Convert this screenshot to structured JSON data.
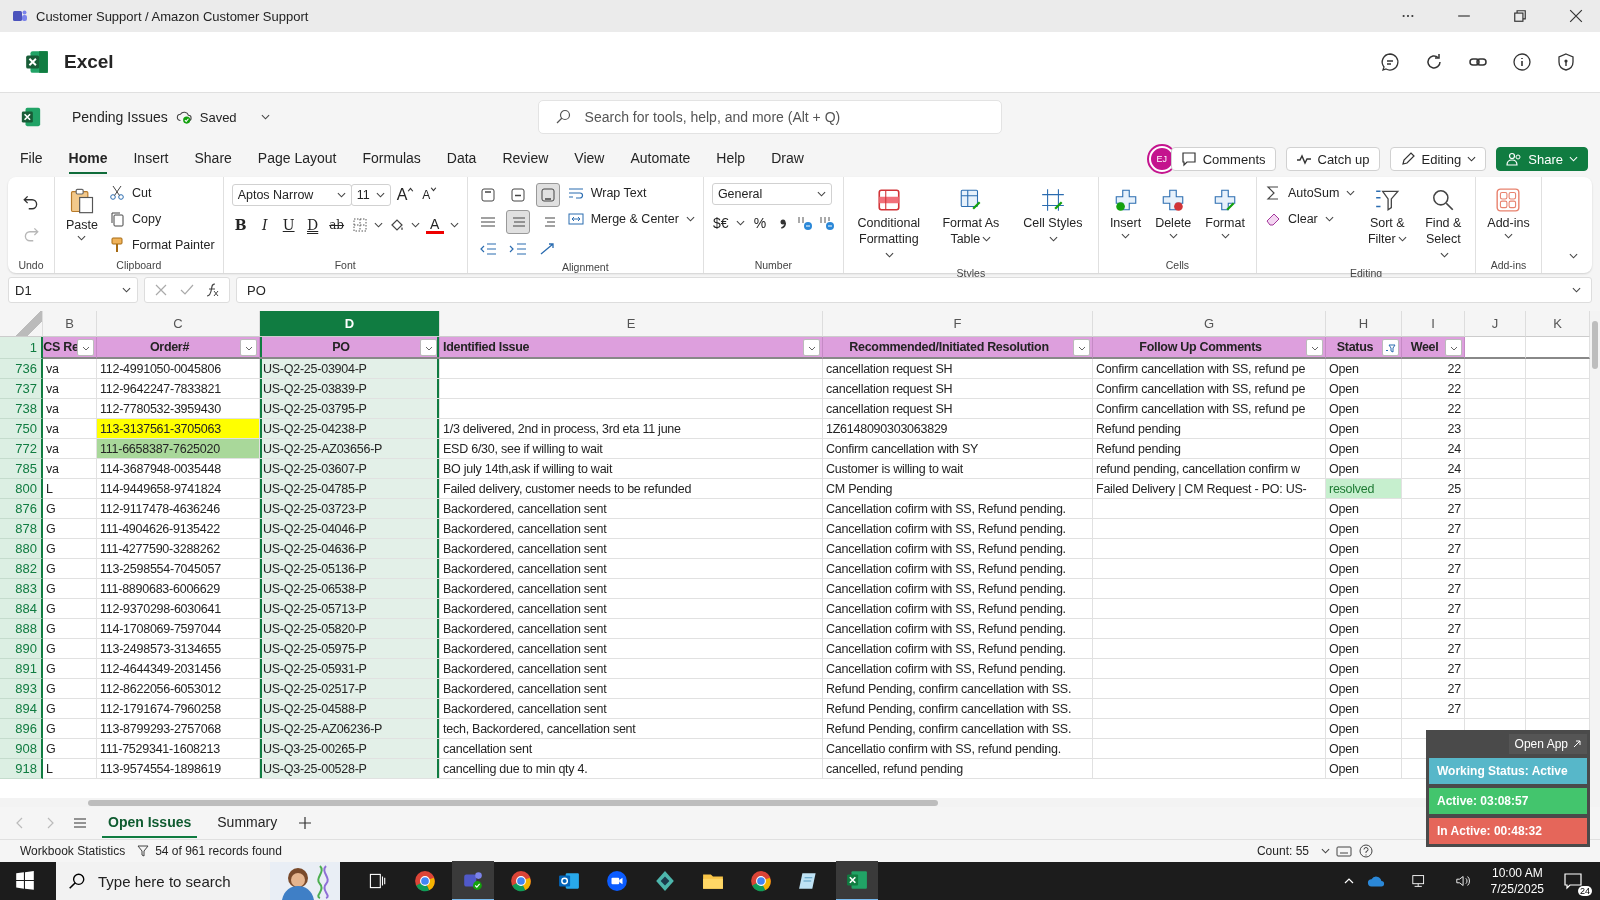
{
  "title_bar": {
    "title": "Customer Support / Amazon Customer Support"
  },
  "app_header": {
    "app_name": "Excel"
  },
  "document": {
    "name": "Pending Issues",
    "save_status": "Saved"
  },
  "search": {
    "placeholder": "Search for tools, help, and more (Alt + Q)"
  },
  "menu_tabs": [
    {
      "label": "File",
      "selected": false
    },
    {
      "label": "Home",
      "selected": true
    },
    {
      "label": "Insert",
      "selected": false
    },
    {
      "label": "Share",
      "selected": false
    },
    {
      "label": "Page Layout",
      "selected": false
    },
    {
      "label": "Formulas",
      "selected": false
    },
    {
      "label": "Data",
      "selected": false
    },
    {
      "label": "Review",
      "selected": false
    },
    {
      "label": "View",
      "selected": false
    },
    {
      "label": "Automate",
      "selected": false
    },
    {
      "label": "Help",
      "selected": false
    },
    {
      "label": "Draw",
      "selected": false
    }
  ],
  "collaboration": {
    "avatar": "EJ",
    "comments": "Comments",
    "catch_up": "Catch up",
    "mode": "Editing",
    "share": "Share"
  },
  "ribbon": {
    "undo": {
      "label": "Undo",
      "undo_disabled": false,
      "redo_disabled": true
    },
    "clipboard": {
      "label": "Clipboard",
      "paste": "Paste",
      "cut": "Cut",
      "copy": "Copy",
      "format_painter": "Format Painter"
    },
    "font": {
      "label": "Font",
      "family": "Aptos Narrow",
      "size": "11",
      "grow": "A",
      "shrink": "A",
      "format_buttons": [
        "B",
        "I",
        "U",
        "D",
        "ab"
      ],
      "font_color": "A"
    },
    "alignment": {
      "label": "Alignment",
      "vertical": [
        {
          "selected": false
        },
        {
          "selected": false
        },
        {
          "selected": true
        }
      ],
      "horizontal": [
        {
          "selected": false
        },
        {
          "selected": true
        },
        {
          "selected": false
        }
      ],
      "wrap": "Wrap Text",
      "merge": "Merge & Center"
    },
    "number": {
      "label": "Number",
      "format": "General",
      "currency": "$€",
      "percent": "%"
    },
    "styles": {
      "label": "Styles",
      "buttons": [
        "Conditional Formatting",
        "Format As Table",
        "Cell Styles"
      ]
    },
    "cells": {
      "label": "Cells",
      "buttons": [
        "Insert",
        "Delete",
        "Format"
      ]
    },
    "editing": {
      "label": "Editing",
      "autosum": "AutoSum",
      "clear": "Clear",
      "sort": "Sort & Filter",
      "find": "Find & Select"
    },
    "addins": {
      "label": "Add-ins",
      "button": "Add-ins"
    }
  },
  "formula_bar": {
    "name_box": "D1",
    "formula": "PO"
  },
  "sheet": {
    "header_row": "1",
    "columns": [
      {
        "letter": "B",
        "header": "CS Re",
        "selected": false,
        "filtered": false
      },
      {
        "letter": "C",
        "header": "Order#",
        "selected": false,
        "filtered": false
      },
      {
        "letter": "D",
        "header": "PO",
        "selected": true,
        "filtered": false
      },
      {
        "letter": "E",
        "header": "Identified Issue",
        "selected": false,
        "filtered": false
      },
      {
        "letter": "F",
        "header": "Recommended/Initiated Resolution",
        "selected": false,
        "filtered": false
      },
      {
        "letter": "G",
        "header": "Follow Up Comments",
        "selected": false,
        "filtered": false
      },
      {
        "letter": "H",
        "header": "Status",
        "selected": false,
        "filtered": true
      },
      {
        "letter": "I",
        "header": "Weel",
        "selected": false,
        "filtered": false
      },
      {
        "letter": "J",
        "selected": false
      },
      {
        "letter": "K",
        "selected": false
      }
    ],
    "rows": [
      {
        "number": "736",
        "rep": "va",
        "order": "112-4991050-0045806",
        "po": "US-Q2-25-03904-P",
        "resolution": "cancellation request SH",
        "follow_up": "Confirm cancellation with SS, refund pe",
        "status": "Open",
        "week": "22"
      },
      {
        "number": "737",
        "rep": "va",
        "order": "112-9642247-7833821",
        "po": "US-Q2-25-03839-P",
        "resolution": "cancellation request SH",
        "follow_up": "Confirm cancellation with SS, refund pe",
        "status": "Open",
        "week": "22"
      },
      {
        "number": "738",
        "rep": "va",
        "order": "112-7780532-3959430",
        "po": "US-Q2-25-03795-P",
        "resolution": "cancellation request SH",
        "follow_up": "Confirm cancellation with SS, refund pe",
        "status": "Open",
        "week": "22"
      },
      {
        "number": "750",
        "rep": "va",
        "order": {
          "text": "113-3137561-3705063",
          "color": "#ffff00"
        },
        "po": "US-Q2-25-04238-P",
        "issue": "1/3 delivered, 2nd in process, 3rd eta 11 june",
        "resolution": "1Z6148090303063829",
        "follow_up": "Refund pending",
        "status": "Open",
        "week": "23"
      },
      {
        "number": "772",
        "rep": "va",
        "order": {
          "text": "111-6658387-7625020",
          "color": "#a9d89a"
        },
        "po": "US-Q2-25-AZ03656-P",
        "issue": "ESD 6/30, see if willing to wait",
        "resolution": "Confirm cancellation with SY",
        "follow_up": "Refund pending",
        "status": "Open",
        "week": "24"
      },
      {
        "number": "785",
        "rep": "va",
        "order": "114-3687948-0035448",
        "po": "US-Q2-25-03607-P",
        "issue": "BO july 14th,ask if willing to wait",
        "resolution": "Customer is willing to wait",
        "follow_up": "refund pending, cancellation confirm w",
        "status": "Open",
        "week": "24"
      },
      {
        "number": "800",
        "rep": "L",
        "order": "114-9449658-9741824",
        "po": "US-Q2-25-04785-P",
        "issue": "Failed delivery, customer needs to be refunded",
        "resolution": "CM Pending",
        "follow_up": "Failed Delivery | CM Request - PO: US-",
        "status": {
          "text": "resolved",
          "color": "#c6efce"
        },
        "week": "25"
      },
      {
        "number": "876",
        "rep": "G",
        "order": "112-9117478-4636246",
        "po": "US-Q2-25-03723-P",
        "issue": "Backordered, cancellation sent",
        "resolution": "Cancellation cofirm with SS, Refund pending.",
        "status": "Open",
        "week": "27"
      },
      {
        "number": "878",
        "rep": "G",
        "order": "111-4904626-9135422",
        "po": "US-Q2-25-04046-P",
        "issue": "Backordered, cancellation sent",
        "resolution": "Cancellation cofirm with SS, Refund pending.",
        "status": "Open",
        "week": "27"
      },
      {
        "number": "880",
        "rep": "G",
        "order": "111-4277590-3288262",
        "po": "US-Q2-25-04636-P",
        "issue": "Backordered, cancellation sent",
        "resolution": "Cancellation cofirm with SS, Refund pending.",
        "status": "Open",
        "week": "27"
      },
      {
        "number": "882",
        "rep": "G",
        "order": "113-2598554-7045057",
        "po": "US-Q2-25-05136-P",
        "issue": "Backordered, cancellation sent",
        "resolution": "Cancellation cofirm with SS, Refund pending.",
        "status": "Open",
        "week": "27"
      },
      {
        "number": "883",
        "rep": "G",
        "order": "111-8890683-6006629",
        "po": "US-Q2-25-06538-P",
        "issue": "Backordered, cancellation sent",
        "resolution": "Cancellation cofirm with SS, Refund pending.",
        "status": "Open",
        "week": "27"
      },
      {
        "number": "884",
        "rep": "G",
        "order": "112-9370298-6030641",
        "po": "US-Q2-25-05713-P",
        "issue": "Backordered, cancellation sent",
        "resolution": "Cancellation cofirm with SS, Refund pending.",
        "status": "Open",
        "week": "27"
      },
      {
        "number": "888",
        "rep": "G",
        "order": "114-1708069-7597044",
        "po": "US-Q2-25-05820-P",
        "issue": "Backordered, cancellation sent",
        "resolution": "Cancellation cofirm with SS, Refund pending.",
        "status": "Open",
        "week": "27"
      },
      {
        "number": "890",
        "rep": "G",
        "order": "113-2498573-3134655",
        "po": "US-Q2-25-05975-P",
        "issue": "Backordered, cancellation sent",
        "resolution": "Cancellation cofirm with SS, Refund pending.",
        "status": "Open",
        "week": "27"
      },
      {
        "number": "891",
        "rep": "G",
        "order": "112-4644349-2031456",
        "po": "US-Q2-25-05931-P",
        "issue": "Backordered, cancellation sent",
        "resolution": "Cancellation cofirm with SS, Refund pending.",
        "status": "Open",
        "week": "27"
      },
      {
        "number": "893",
        "rep": "G",
        "order": "112-8622056-6053012",
        "po": "US-Q2-25-02517-P",
        "issue": "Backordered, cancellation sent",
        "resolution": "Refund Pending, confirm cancellation with SS.",
        "status": "Open",
        "week": "27"
      },
      {
        "number": "894",
        "rep": "G",
        "order": "112-1791674-7960258",
        "po": "US-Q2-25-04588-P",
        "issue": "Backordered, cancellation sent",
        "resolution": "Refund Pending, confirm cancellation with SS.",
        "status": "Open",
        "week": "27"
      },
      {
        "number": "896",
        "rep": "G",
        "order": "113-8799293-2757068",
        "po": "US-Q2-25-AZ06236-P",
        "issue": "tech, Backordered, cancellation sent",
        "resolution": "Refund Pending, confirm cancellation with SS.",
        "status": "Open"
      },
      {
        "number": "908",
        "rep": "G",
        "order": "111-7529341-1608213",
        "po": "US-Q3-25-00265-P",
        "issue": "cancellation sent",
        "resolution": "Cancellatio confirm with SS, refund pending.",
        "status": "Open"
      },
      {
        "number": "918",
        "rep": "L",
        "order": "113-9574554-1898619",
        "po": "US-Q3-25-00528-P",
        "issue": "cancelling due to min qty 4.",
        "resolution": "cancelled, refund pending",
        "status": "Open"
      }
    ]
  },
  "sheet_tabs": [
    {
      "label": "Open Issues",
      "selected": true
    },
    {
      "label": "Summary",
      "selected": false
    }
  ],
  "status_bar": {
    "statistics": "Workbook Statistics",
    "records": "54 of 961 records found",
    "count": "Count: 55"
  },
  "timer_widget": {
    "open_app": "Open App",
    "working_status": "Working Status: Active",
    "active": "Active: 03:08:57",
    "inactive": "In Active: 00:48:32"
  },
  "taskbar": {
    "search_placeholder": "Type here to search",
    "time": "10:00 AM",
    "date": "7/25/2025",
    "notifications": "24"
  }
}
